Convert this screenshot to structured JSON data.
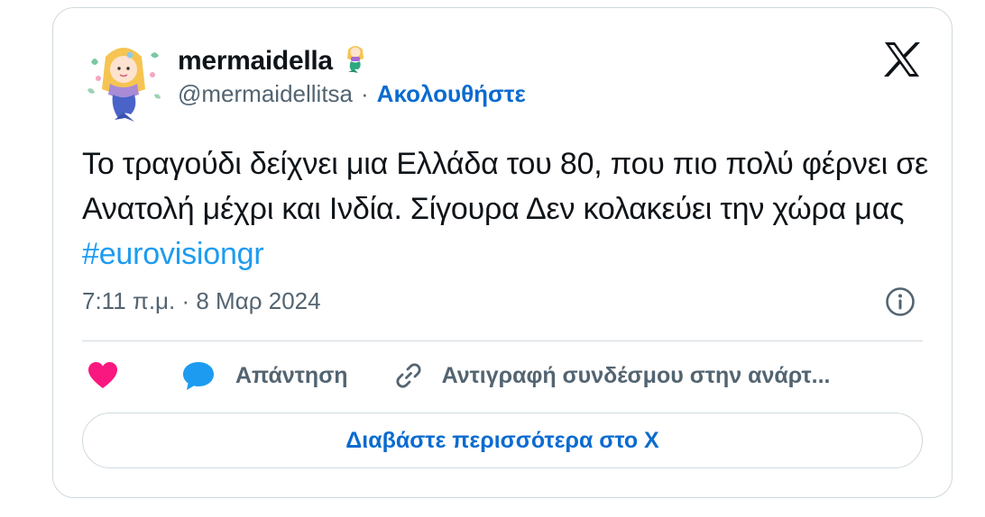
{
  "author": {
    "display_name": "mermaidella",
    "name_emoji": "🧜‍♀️",
    "handle": "@mermaidellitsa",
    "separator": "·",
    "follow_label": "Ακολουθήστε"
  },
  "tweet": {
    "text": "Το τραγούδι δείχνει μια Ελλάδα του 80, που πιο πολύ φέρνει σε Ανατολή μέχρι και Ινδία. Σίγουρα Δεν κολακεύει  την χώρα μας ",
    "hashtag": "#eurovisiongr",
    "timestamp": "7:11 π.μ. · 8 Μαρ 2024"
  },
  "actions": {
    "reply_label": "Απάντηση",
    "copy_link_label": "Αντιγραφή συνδέσμου στην ανάρτ..."
  },
  "read_more_label": "Διαβάστε περισσότερα στο X",
  "colors": {
    "link": "#0b6bd0",
    "hashtag": "#1d9bf0",
    "like": "#f91880",
    "reply_icon": "#1d9bf0",
    "muted": "#536471",
    "border": "#cfd9de"
  },
  "icons": {
    "logo": "x-logo-icon",
    "info": "info-icon",
    "like": "heart-icon",
    "reply": "speech-bubble-icon",
    "copy": "link-icon"
  }
}
